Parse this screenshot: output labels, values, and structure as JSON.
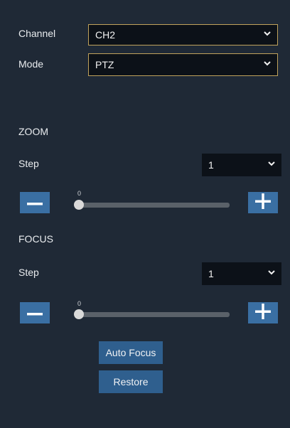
{
  "channel": {
    "label": "Channel",
    "value": "CH2"
  },
  "mode": {
    "label": "Mode",
    "value": "PTZ"
  },
  "zoom": {
    "section_label": "ZOOM",
    "step_label": "Step",
    "step_value": "1",
    "slider_value": "0",
    "level_fraction": 0
  },
  "focus": {
    "section_label": "FOCUS",
    "step_label": "Step",
    "step_value": "1",
    "slider_value": "0",
    "level_fraction": 0
  },
  "buttons": {
    "auto_focus": "Auto Focus",
    "restore": "Restore"
  },
  "icons": {
    "dropdown": "chevron-down-icon",
    "decrease": "minus-icon",
    "increase": "plus-icon"
  },
  "colors": {
    "background": "#1f2936",
    "accent_button": "#3a6fa3",
    "field_border": "#c0a25b"
  }
}
